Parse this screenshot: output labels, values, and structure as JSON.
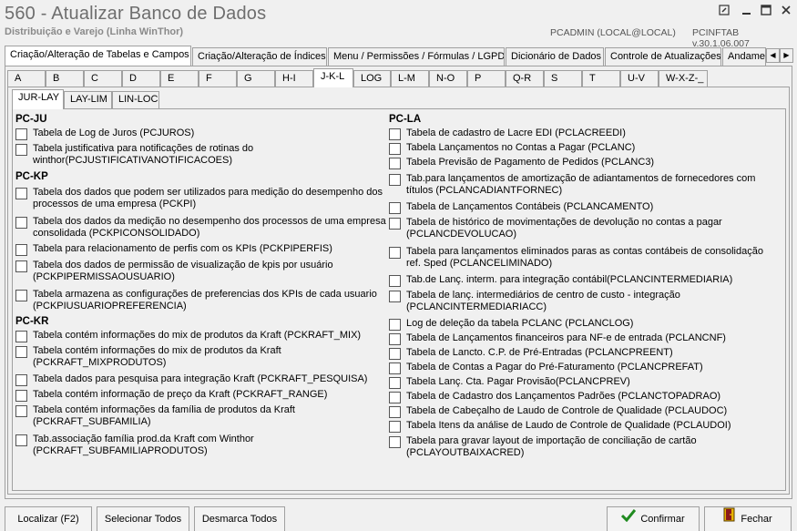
{
  "window": {
    "title": "560 - Atualizar Banco de Dados",
    "subtitle": "Distribuição e Varejo (Linha WinThor)",
    "user": "PCADMIN (LOCAL@LOCAL)",
    "version": "PCINFTAB  v.30.1.06.007"
  },
  "main_tabs": [
    {
      "label": "Criação/Alteração de Tabelas e Campos"
    },
    {
      "label": "Criação/Alteração de Índices"
    },
    {
      "label": "Menu / Permissões / Fórmulas / LGPD"
    },
    {
      "label": "Dicionário de Dados"
    },
    {
      "label": "Controle de Atualizações"
    },
    {
      "label": "Andamento"
    }
  ],
  "letter_tabs": [
    {
      "label": "A"
    },
    {
      "label": "B"
    },
    {
      "label": "C"
    },
    {
      "label": "D"
    },
    {
      "label": "E"
    },
    {
      "label": "F"
    },
    {
      "label": "G"
    },
    {
      "label": "H-I"
    },
    {
      "label": "J-K-L"
    },
    {
      "label": "LOG"
    },
    {
      "label": "L-M"
    },
    {
      "label": "N-O"
    },
    {
      "label": "P"
    },
    {
      "label": "Q-R"
    },
    {
      "label": "S"
    },
    {
      "label": "T"
    },
    {
      "label": "U-V"
    },
    {
      "label": "W-X-Z-_"
    }
  ],
  "sub_tabs": [
    {
      "label": "JUR-LAY"
    },
    {
      "label": "LAY-LIM"
    },
    {
      "label": "LIN-LOC"
    }
  ],
  "left_column": {
    "groups": [
      {
        "title": "PC-JU",
        "items": [
          {
            "line1": "Tabela de Log de Juros (PCJUROS)",
            "line2": ""
          },
          {
            "line1": "Tabela justificativa para notificações de rotinas do",
            "line2": "winthor(PCJUSTIFICATIVANOTIFICACOES)"
          }
        ]
      },
      {
        "title": "PC-KP",
        "items": [
          {
            "line1": "Tabela dos dados que podem ser utilizados para medição do desempenho dos",
            "line2": "processos de uma empresa (PCKPI)"
          },
          {
            "line1": "Tabela dos dados da medição no desempenho dos processos de uma empresa",
            "line2": "consolidada (PCKPICONSOLIDADO)"
          },
          {
            "line1": "Tabela para relacionamento de perfis com os KPIs (PCKPIPERFIS)",
            "line2": ""
          },
          {
            "line1": "Tabela dos dados de permissão de visualização de kpis por usuário",
            "line2": "(PCKPIPERMISSAOUSUARIO)"
          },
          {
            "line1": "Tabela armazena as configurações de preferencias dos KPIs de cada usuario",
            "line2": "(PCKPIUSUARIOPREFERENCIA)"
          }
        ]
      },
      {
        "title": "PC-KR",
        "items": [
          {
            "line1": "Tabela contém informações do mix de produtos da Kraft (PCKRAFT_MIX)",
            "line2": ""
          },
          {
            "line1": "Tabela contém informações do mix de produtos da Kraft",
            "line2": "(PCKRAFT_MIXPRODUTOS)"
          },
          {
            "line1": "Tabela dados para pesquisa para integração Kraft (PCKRAFT_PESQUISA)",
            "line2": ""
          },
          {
            "line1": "Tabela contém informação de preço da Kraft (PCKRAFT_RANGE)",
            "line2": ""
          },
          {
            "line1": "Tabela contém informações da família de produtos da Kraft",
            "line2": "(PCKRAFT_SUBFAMILIA)"
          },
          {
            "line1": "Tab.associação família prod.da Kraft com Winthor",
            "line2": "(PCKRAFT_SUBFAMILIAPRODUTOS)"
          }
        ]
      }
    ]
  },
  "right_column": {
    "groups": [
      {
        "title": "PC-LA",
        "items": [
          {
            "line1": "Tabela de cadastro de Lacre EDI (PCLACREEDI)",
            "line2": ""
          },
          {
            "line1": "Tabela Lançamentos no Contas a Pagar (PCLANC)",
            "line2": ""
          },
          {
            "line1": "Tabela Previsão de Pagamento de Pedidos (PCLANC3)",
            "line2": ""
          },
          {
            "line1": "Tab.para lançamentos de amortização de adiantamentos de fornecedores com",
            "line2": "títulos (PCLANCADIANTFORNEC)"
          },
          {
            "line1": "Tabela de Lançamentos Contábeis (PCLANCAMENTO)",
            "line2": ""
          },
          {
            "line1": "Tabela de histórico de movimentações de devolução no contas a pagar",
            "line2": "(PCLANCDEVOLUCAO)"
          },
          {
            "line1": "Tabela para lançamentos eliminados paras as contas contábeis de consolidação",
            "line2": "ref. Sped (PCLANCELIMINADO)"
          },
          {
            "line1": "Tab.de Lanç. interm. para integração contábil(PCLANCINTERMEDIARIA)",
            "line2": ""
          },
          {
            "line1": "Tabela de lanç.  intermediários de centro de custo - integração",
            "line2": "(PCLANCINTERMEDIARIACC)"
          },
          {
            "line1": "Log de deleção da tabela PCLANC (PCLANCLOG)",
            "line2": ""
          },
          {
            "line1": "Tabela de Lançamentos financeiros para NF-e de entrada (PCLANCNF)",
            "line2": ""
          },
          {
            "line1": "Tabela de Lancto. C.P. de Pré-Entradas (PCLANCPREENT)",
            "line2": ""
          },
          {
            "line1": "Tabela de Contas a Pagar do Pré-Faturamento (PCLANCPREFAT)",
            "line2": ""
          },
          {
            "line1": "Tabela Lanç. Cta. Pagar Provisão(PCLANCPREV)",
            "line2": ""
          },
          {
            "line1": "Tabela de Cadastro dos Lançamentos Padrões (PCLANCTOPADRAO)",
            "line2": ""
          },
          {
            "line1": "Tabela de Cabeçalho de Laudo de Controle de Qualidade (PCLAUDOC)",
            "line2": ""
          },
          {
            "line1": "Tabela Itens da análise de Laudo de Controle de Qualidade (PCLAUDOI)",
            "line2": ""
          },
          {
            "line1": "Tabela para gravar layout de importação de conciliação de cartão",
            "line2": "(PCLAYOUTBAIXACRED)"
          }
        ]
      }
    ]
  },
  "buttons": {
    "localizar": "Localizar (F2)",
    "selecionar": "Selecionar Todos",
    "desmarca": "Desmarca Todos",
    "confirmar": "Confirmar",
    "fechar": "Fechar"
  }
}
